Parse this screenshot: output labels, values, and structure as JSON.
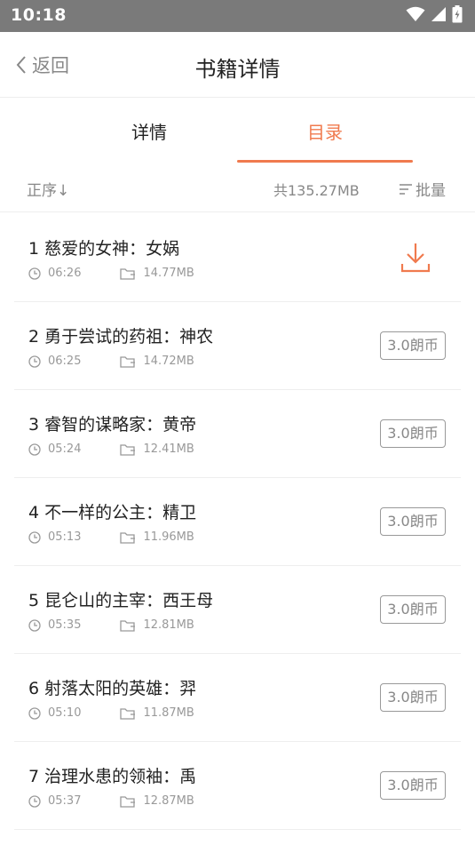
{
  "status": {
    "time": "10:18",
    "icons": [
      "wifi-icon",
      "signal-icon",
      "battery-charging-icon"
    ]
  },
  "nav": {
    "back_label": "返回",
    "title": "书籍详情"
  },
  "tabs": [
    {
      "label": "详情"
    },
    {
      "label": "目录",
      "active": true
    }
  ],
  "toolbar": {
    "sort_label": "正序↓",
    "total_size": "共135.27MB",
    "batch_label": "批量"
  },
  "colors": {
    "accent": "#f07a4e",
    "status_bar": "#7a7a7a",
    "text_primary": "#222222",
    "text_secondary": "#888888"
  },
  "episodes": [
    {
      "title": "1 慈爱的女神：女娲",
      "duration": "06:26",
      "size": "14.77MB",
      "action": "download"
    },
    {
      "title": "2 勇于尝试的药祖：神农",
      "duration": "06:25",
      "size": "14.72MB",
      "action": "price",
      "price": "3.0朗币"
    },
    {
      "title": "3 睿智的谋略家：黄帝",
      "duration": "05:24",
      "size": "12.41MB",
      "action": "price",
      "price": "3.0朗币"
    },
    {
      "title": "4 不一样的公主：精卫",
      "duration": "05:13",
      "size": "11.96MB",
      "action": "price",
      "price": "3.0朗币"
    },
    {
      "title": "5 昆仑山的主宰：西王母",
      "duration": "05:35",
      "size": "12.81MB",
      "action": "price",
      "price": "3.0朗币"
    },
    {
      "title": "6 射落太阳的英雄：羿",
      "duration": "05:10",
      "size": "11.87MB",
      "action": "price",
      "price": "3.0朗币"
    },
    {
      "title": "7 治理水患的领袖：禹",
      "duration": "05:37",
      "size": "12.87MB",
      "action": "price",
      "price": "3.0朗币"
    }
  ]
}
